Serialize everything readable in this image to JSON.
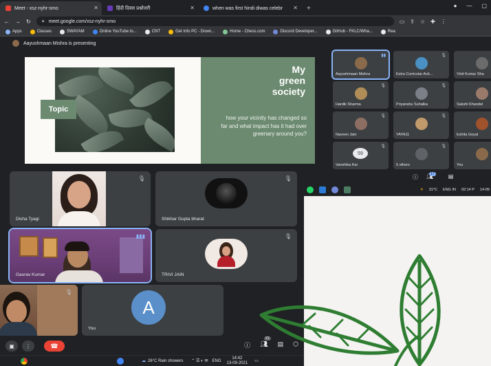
{
  "browser": {
    "tabs": [
      {
        "title": "Meet - xsz-nyhr-smo",
        "fav": "#ea4335",
        "active": true
      },
      {
        "title": "हिंदी दिवस प्रश्नोत्तरी",
        "fav": "#673ab7",
        "active": false
      },
      {
        "title": "when was first hindi diwas celebr",
        "fav": "#4285f4",
        "active": false
      }
    ],
    "new_tab": "+",
    "url": "meet.google.com/xsz-nyhr-smo",
    "bookmarks": [
      {
        "label": "Apps",
        "color": "#8ab4f8"
      },
      {
        "label": "Classes",
        "color": "#fbbc04"
      },
      {
        "label": "SWAYAM",
        "color": "#e8eaed"
      },
      {
        "label": "Online YouTube to...",
        "color": "#4285f4"
      },
      {
        "label": "CNT",
        "color": "#e8eaed"
      },
      {
        "label": "Get Info PC - Down...",
        "color": "#fbbc04"
      },
      {
        "label": "Home - Chess.com",
        "color": "#81c995"
      },
      {
        "label": "Discord Developer...",
        "color": "#7289da"
      },
      {
        "label": "GitHub - FKLC/Wha...",
        "color": "#e8eaed"
      },
      {
        "label": "Rea",
        "color": "#e8eaed"
      }
    ]
  },
  "meet_top": {
    "presenting_text": "Aayushmaan Mishra is presenting",
    "slide": {
      "topic_label": "Topic",
      "title_lines": [
        "My",
        "green",
        "society"
      ],
      "body": "how your vicinity has changed so far and what impact has it had over greenary around you?"
    },
    "participants": [
      {
        "name": "Aayushmaan Mishra",
        "color": "#8a6a4a",
        "speaking": true
      },
      {
        "name": "Extra Curricular Acti...",
        "color": "#4a90c2",
        "speaking": false
      },
      {
        "name": "Vinit Kumar Sha",
        "color": "#6b6b6b",
        "speaking": false
      },
      {
        "name": "Hardik Sharma",
        "color": "#b08d57",
        "speaking": false
      },
      {
        "name": "Priyanshu Suhalka",
        "color": "#7a7f88",
        "speaking": false
      },
      {
        "name": "Sakshi Khandel",
        "color": "#9a7a6a",
        "speaking": false
      },
      {
        "name": "Naveen Jain",
        "color": "#8d6e63",
        "speaking": false
      },
      {
        "name": "YAYA11",
        "color": "#c19a6b",
        "speaking": false
      },
      {
        "name": "Eshita Goyal",
        "color": "#a0522d",
        "speaking": false
      },
      {
        "name": "Vanshika Kar",
        "color": "#9e9e9e",
        "speaking": false
      },
      {
        "name": "5 others",
        "color": "#5f6368",
        "speaking": false
      },
      {
        "name": "You",
        "color": "#8a6a4a",
        "speaking": false
      }
    ],
    "vanshika_badge": "59",
    "controls": {
      "people_count": "17"
    },
    "taskbar": {
      "weather": "31°C",
      "lang": "ENG IN",
      "time": "02:14 P",
      "date": "14-09"
    }
  },
  "meet_bottom": {
    "participants": [
      {
        "name": "Disha Tyagi"
      },
      {
        "name": "Shikhar Gupta bharat"
      },
      {
        "name": "Gaurav Kumar"
      },
      {
        "name": "TRIVI JAIN"
      },
      {
        "name": "You",
        "avatar_letter": "A"
      }
    ],
    "controls": {
      "people_count": "21"
    },
    "taskbar": {
      "weather": "26°C Rain showers",
      "lang": "ENG",
      "time": "14:42",
      "date": "13-09-2021"
    }
  },
  "colors": {
    "meet_bg": "#202124",
    "tile_bg": "#3c4043",
    "slide_green": "#6b8a70",
    "end_call": "#ea4335",
    "speaking": "#8ab4f8",
    "deco_leaf": "#2e7d32"
  }
}
